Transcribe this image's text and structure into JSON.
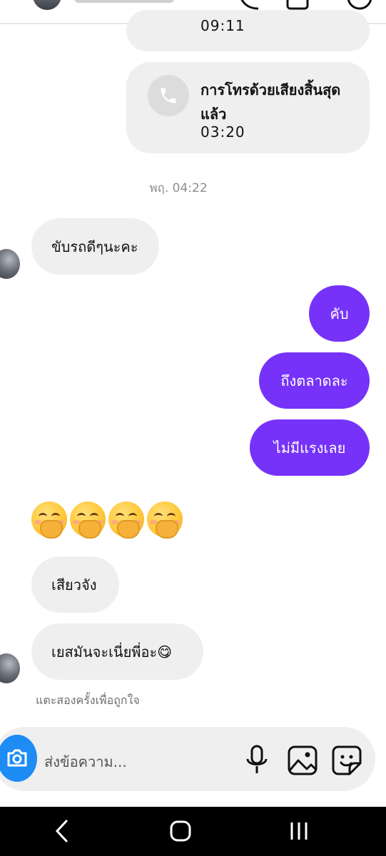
{
  "call": {
    "prev_duration": "09:11",
    "title": "การโทรด้วยเสียงสิ้นสุดแล้ว",
    "duration": "03:20"
  },
  "timestamp": "พฤ. 04:22",
  "messages": {
    "m1": "ขับรถดีๆนะคะ",
    "m2": "คับ",
    "m3": "ถึงตลาดละ",
    "m4": "ไม่มีแรงเลย",
    "m5": "เสียวจัง",
    "m6": "เยสมันจะเนี่ยพี่อะ😋"
  },
  "hint": "แตะสองครั้งเพื่อถูกใจ",
  "composer": {
    "placeholder": "ส่งข้อความ..."
  },
  "colors": {
    "sent": "#7632f8",
    "received": "#efefef",
    "camera": "#1d8cf5"
  },
  "icons": [
    "phone-icon",
    "camera-icon",
    "microphone-icon",
    "gallery-icon",
    "sticker-icon",
    "back-icon",
    "home-icon",
    "recents-icon"
  ]
}
